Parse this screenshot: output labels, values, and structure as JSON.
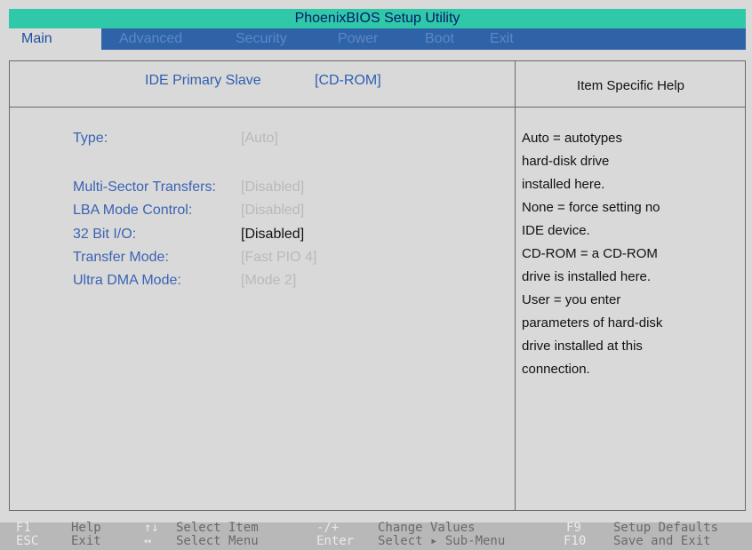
{
  "title": "PhoenixBIOS Setup Utility",
  "menu": [
    {
      "label": "Main",
      "active": true
    },
    {
      "label": "Advanced",
      "active": false
    },
    {
      "label": "Security",
      "active": false
    },
    {
      "label": "Power",
      "active": false
    },
    {
      "label": "Boot",
      "active": false
    },
    {
      "label": "Exit",
      "active": false
    }
  ],
  "header": {
    "device": "IDE Primary Slave",
    "device_value": "[CD-ROM]",
    "help_title": "Item  Specific  Help"
  },
  "settings": [
    {
      "label": "Type:",
      "value": "[Auto]",
      "selected": false
    },
    {
      "label": "Multi-Sector Transfers:",
      "value": "[Disabled]",
      "selected": false
    },
    {
      "label": "LBA Mode Control:",
      "value": "[Disabled]",
      "selected": false
    },
    {
      "label": "32 Bit I/O:",
      "value": "[Disabled]",
      "selected": true
    },
    {
      "label": "Transfer Mode:",
      "value": "[Fast PIO 4]",
      "selected": false
    },
    {
      "label": "Ultra DMA Mode:",
      "value": "[Mode 2]",
      "selected": false
    }
  ],
  "help_lines": [
    "Auto = autotypes",
    "hard-disk drive",
    "installed here.",
    "None = force setting no",
    "IDE device.",
    "CD-ROM = a CD-ROM",
    "drive is installed here.",
    "User = you enter",
    "parameters of hard-disk",
    "drive installed at this",
    "connection."
  ],
  "footer": {
    "row1": [
      {
        "key": "F1",
        "desc": "Help"
      },
      {
        "key": "↑↓",
        "desc": "Select Item"
      },
      {
        "key": "-/+",
        "desc": "Change Values"
      },
      {
        "key": "F9",
        "desc": "Setup Defaults"
      }
    ],
    "row2": [
      {
        "key": "ESC",
        "desc": "Exit"
      },
      {
        "key": "↔",
        "desc": "Select Menu"
      },
      {
        "key": "Enter",
        "desc": "Select ▸ Sub-Menu"
      },
      {
        "key": "F10",
        "desc": "Save and Exit"
      }
    ]
  },
  "colors": {
    "title_bg": "#2fc8a8",
    "menu_bg": "#2f63a8",
    "panel_bg": "#d9d9d9",
    "label_blue": "#3a63b4"
  }
}
